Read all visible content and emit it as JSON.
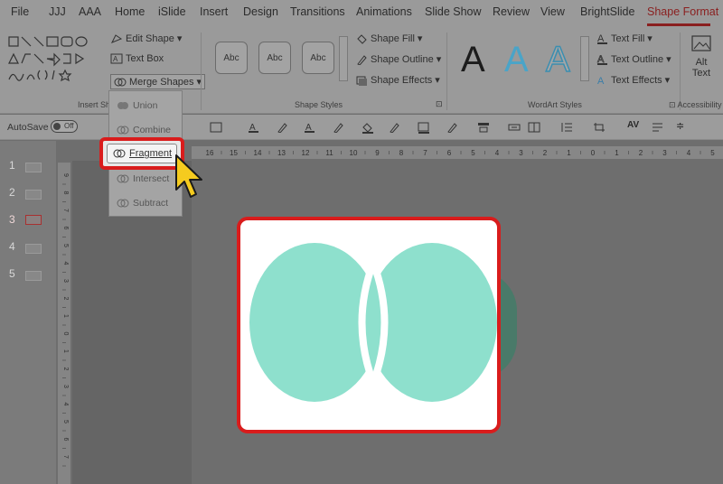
{
  "menu": {
    "tabs": [
      "File",
      "JJJ",
      "AAA",
      "Home",
      "iSlide",
      "Insert",
      "Design",
      "Transitions",
      "Animations",
      "Slide Show",
      "Review",
      "View",
      "BrightSlide",
      "Shape Format"
    ],
    "active": "Shape Format"
  },
  "ribbon": {
    "insert_shapes": {
      "edit_shape": "Edit Shape",
      "text_box": "Text Box",
      "merge_shapes": "Merge Shapes",
      "label": "Insert Sh"
    },
    "shape_styles": {
      "gallery": [
        "Abc",
        "Abc",
        "Abc"
      ],
      "shape_fill": "Shape Fill",
      "shape_outline": "Shape Outline",
      "shape_effects": "Shape Effects",
      "label": "Shape Styles"
    },
    "wordart_styles": {
      "letters": [
        "A",
        "A",
        "A"
      ],
      "text_fill": "Text Fill",
      "text_outline": "Text Outline",
      "text_effects": "Text Effects",
      "label": "WordArt Styles"
    },
    "accessibility": {
      "alt_text_line1": "Alt",
      "alt_text_line2": "Text",
      "label": "Accessibility"
    }
  },
  "qat": {
    "autosave_label": "AutoSave",
    "autosave_state": "Off"
  },
  "merge_menu": {
    "items": [
      "Union",
      "Combine",
      "Fragment",
      "Intersect",
      "Subtract"
    ],
    "highlighted": "Fragment"
  },
  "ruler": {
    "horizontal": [
      "16",
      "15",
      "14",
      "13",
      "12",
      "11",
      "10",
      "9",
      "8",
      "7",
      "6",
      "5",
      "4",
      "3",
      "2",
      "1",
      "0",
      "1",
      "2",
      "3",
      "4",
      "5"
    ],
    "vertical": [
      "9",
      "8",
      "7",
      "6",
      "5",
      "4",
      "3",
      "2",
      "1",
      "0",
      "1",
      "2",
      "3",
      "4",
      "5",
      "6",
      "7"
    ]
  },
  "slides": {
    "numbers": [
      "1",
      "2",
      "3",
      "4",
      "5"
    ],
    "active": "3"
  },
  "colors": {
    "shape_fill": "#8ee0cd",
    "highlight_red": "#d91c1c",
    "accent_tab": "#8a1f1f",
    "cursor_yellow": "#f5cb1f"
  }
}
